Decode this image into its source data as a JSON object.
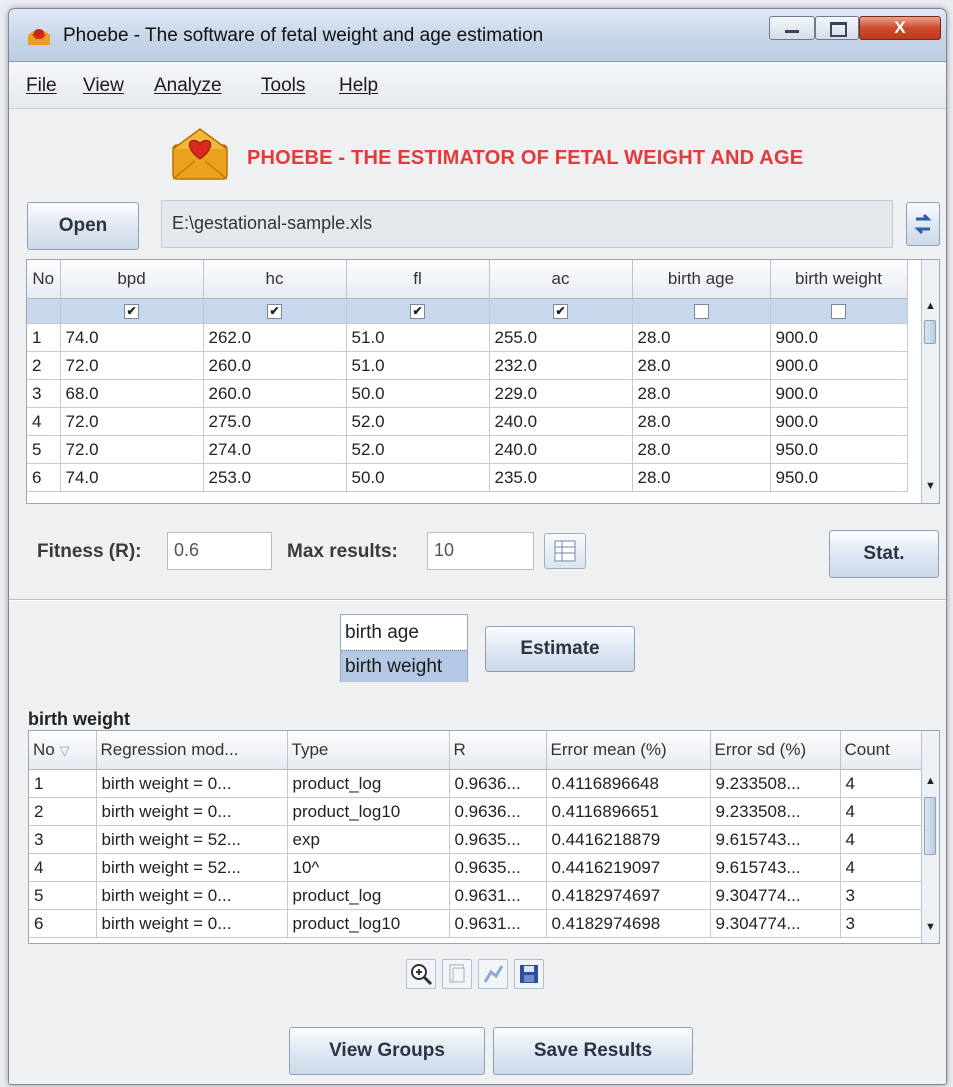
{
  "window": {
    "title": "Phoebe - The software of fetal weight and age estimation",
    "close_glyph": "X"
  },
  "menu": {
    "items": [
      "File",
      "View",
      "Analyze",
      "Tools",
      "Help"
    ]
  },
  "banner": {
    "heading": "PHOEBE - THE ESTIMATOR OF FETAL WEIGHT AND AGE",
    "icon": "envelope-heart-icon"
  },
  "file": {
    "open_label": "Open",
    "path": "E:\\gestational-sample.xls",
    "refresh_icon": "swap-arrows-icon"
  },
  "data_table": {
    "columns": [
      "No",
      "bpd",
      "hc",
      "fl",
      "ac",
      "birth age",
      "birth weight"
    ],
    "checked": [
      null,
      true,
      true,
      true,
      true,
      false,
      false
    ],
    "rows": [
      [
        "1",
        "74.0",
        "262.0",
        "51.0",
        "255.0",
        "28.0",
        "900.0"
      ],
      [
        "2",
        "72.0",
        "260.0",
        "51.0",
        "232.0",
        "28.0",
        "900.0"
      ],
      [
        "3",
        "68.0",
        "260.0",
        "50.0",
        "229.0",
        "28.0",
        "900.0"
      ],
      [
        "4",
        "72.0",
        "275.0",
        "52.0",
        "240.0",
        "28.0",
        "900.0"
      ],
      [
        "5",
        "72.0",
        "274.0",
        "52.0",
        "240.0",
        "28.0",
        "950.0"
      ],
      [
        "6",
        "74.0",
        "253.0",
        "50.0",
        "235.0",
        "28.0",
        "950.0"
      ]
    ]
  },
  "params": {
    "fitness_label": "Fitness (R):",
    "fitness_value": "0.6",
    "max_label": "Max results:",
    "max_value": "10",
    "stat_label": "Stat."
  },
  "estimate": {
    "options": [
      "birth age",
      "birth weight"
    ],
    "selected": "birth weight",
    "button_label": "Estimate"
  },
  "results": {
    "section_title": "birth weight",
    "columns": [
      "No",
      "Regression mod...",
      "Type",
      "R",
      "Error mean (%)",
      "Error sd (%)",
      "Count"
    ],
    "rows": [
      [
        "1",
        "birth weight = 0...",
        "product_log",
        "0.9636...",
        "0.4116896648",
        "9.233508...",
        "4"
      ],
      [
        "2",
        "birth weight = 0...",
        "product_log10",
        "0.9636...",
        "0.4116896651",
        "9.233508...",
        "4"
      ],
      [
        "3",
        "birth weight = 52...",
        "exp",
        "0.9635...",
        "0.4416218879",
        "9.615743...",
        "4"
      ],
      [
        "4",
        "birth weight = 52...",
        "10^",
        "0.9635...",
        "0.4416219097",
        "9.615743...",
        "4"
      ],
      [
        "5",
        "birth weight = 0...",
        "product_log",
        "0.9631...",
        "0.4182974697",
        "9.304774...",
        "3"
      ],
      [
        "6",
        "birth weight = 0...",
        "product_log10",
        "0.9631...",
        "0.4182974698",
        "9.304774...",
        "3"
      ]
    ]
  },
  "tools": [
    "zoom-in-icon",
    "copy-icon",
    "chart-icon",
    "save-disk-icon"
  ],
  "bottom": {
    "view_groups": "View Groups",
    "save_results": "Save Results"
  }
}
